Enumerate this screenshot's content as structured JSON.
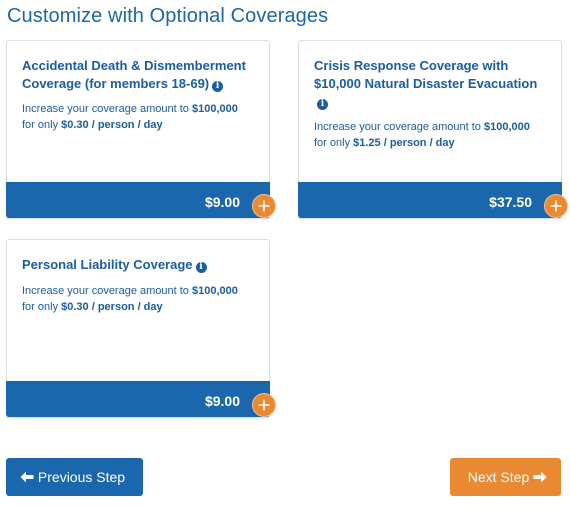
{
  "page": {
    "title": "Customize with Optional Coverages"
  },
  "coverages": [
    {
      "title": "Accidental Death & Dismemberment Coverage (for members 18-69)",
      "desc_prefix": "Increase your coverage amount to ",
      "amount": "$100,000",
      "desc_middle": " for only ",
      "rate": "$0.30 / person / day",
      "price": "$9.00"
    },
    {
      "title": "Crisis Response Coverage with $10,000 Natural Disaster Evacuation",
      "desc_prefix": "Increase your coverage amount to ",
      "amount": "$100,000",
      "desc_middle": " for only ",
      "rate": "$1.25 / person / day",
      "price": "$37.50"
    },
    {
      "title": "Personal Liability Coverage",
      "desc_prefix": "Increase your coverage amount to ",
      "amount": "$100,000",
      "desc_middle": " for only ",
      "rate": "$0.30 / person / day",
      "price": "$9.00"
    }
  ],
  "icons": {
    "info": "info-circle-icon",
    "add": "plus-circle-icon",
    "prev": "arrow-left-icon",
    "next": "arrow-right-icon"
  },
  "nav": {
    "prev_label": "Previous Step",
    "next_label": "Next Step"
  },
  "colors": {
    "primary_blue": "#1b67ad",
    "accent_orange": "#ea8933",
    "text_blue": "#1b5da3"
  }
}
